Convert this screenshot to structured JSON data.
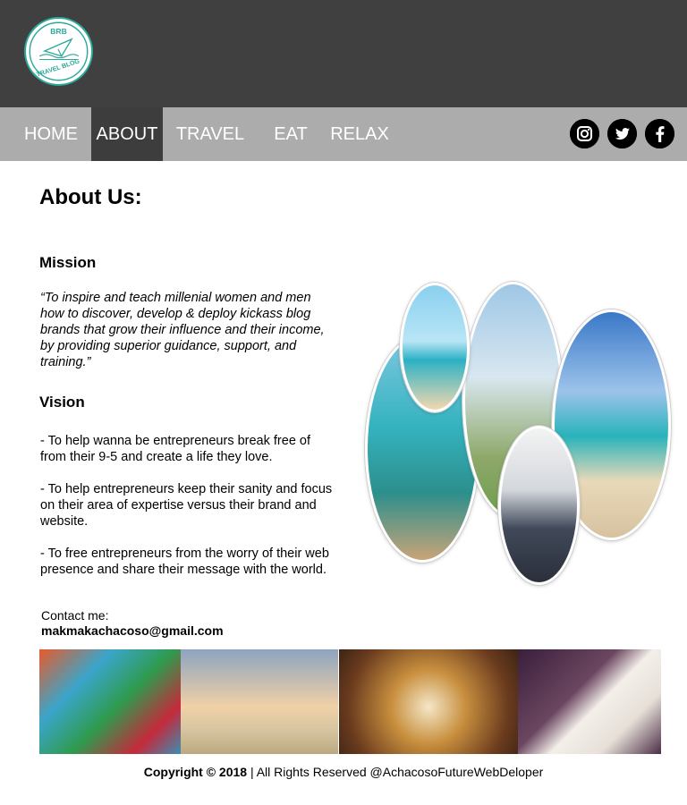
{
  "logo": {
    "line1": "BRB",
    "line2": "TRAVEL BLOG",
    "icon": "paper-plane-icon",
    "color": "#2ea89a"
  },
  "nav": {
    "items": [
      {
        "label": "HOME"
      },
      {
        "label": "ABOUT"
      },
      {
        "label": "TRAVEL"
      },
      {
        "label": "EAT"
      },
      {
        "label": "RELAX"
      }
    ],
    "active": "ABOUT"
  },
  "social": [
    "instagram-icon",
    "twitter-icon",
    "facebook-icon"
  ],
  "page": {
    "title": "About Us:",
    "mission_heading": "Mission",
    "mission_text": "“To inspire and teach millenial women and men how to discover, develop & deploy kickass blog brands that grow their influence and their income, by providing superior guidance, support, and training.”",
    "vision_heading": "Vision",
    "vision_items": [
      "- To help wanna be entrepreneurs break free of from their 9-5 and create a life they love.",
      "- To help entrepreneurs keep their sanity and focus on their area of expertise versus their brand and website.",
      "- To free entrepreneurs from the worry of their web presence and share their message with the world."
    ],
    "contact_label": "Contact me:",
    "contact_email": "makmakachacoso@gmail.com"
  },
  "footer": {
    "copyright_bold": "Copyright © 2018",
    "copyright_rest": " | All Rights Reserved @AchacosoFutureWebDeloper"
  },
  "colors": {
    "header_bg": "#404040",
    "nav_bg": "#acacac",
    "nav_active_bg": "#3d3d3d"
  }
}
